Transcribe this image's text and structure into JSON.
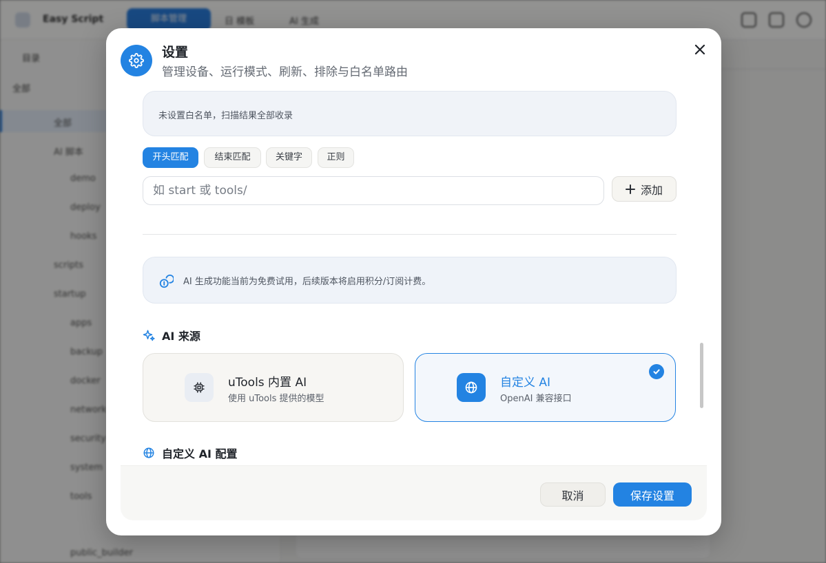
{
  "background_app": {
    "app_name": "Easy Script",
    "active_tab": "脚本管理",
    "tabs": [
      "日 模板",
      "AI 生成"
    ],
    "sidebar_header": "目录",
    "tree_root": "全部",
    "tree_items": [
      "全部",
      "AI 脚本",
      "demo",
      "deploy",
      "hooks",
      "scripts",
      "startup",
      "apps",
      "backup",
      "docker",
      "network",
      "security",
      "system",
      "tools",
      "public_builder"
    ]
  },
  "modal": {
    "title": "设置",
    "subtitle": "管理设备、运行模式、刷新、排除与白名单路由",
    "close_label": "×",
    "whitelist_notice": "未设置白名单，扫描结果全部收录",
    "match_modes": [
      {
        "label": "开头匹配",
        "active": true
      },
      {
        "label": "结束匹配",
        "active": false
      },
      {
        "label": "关键字",
        "active": false
      },
      {
        "label": "正则",
        "active": false
      }
    ],
    "rule_input": {
      "value": "",
      "placeholder": "如 start 或 tools/"
    },
    "add_button": "添加",
    "ai_notice": "AI 生成功能当前为免费试用，后续版本将启用积分/订阅计费。",
    "ai_source_heading": "AI 来源",
    "ai_sources": [
      {
        "title": "uTools 内置 AI",
        "desc": "使用 uTools 提供的模型",
        "icon": "chip-icon",
        "selected": false
      },
      {
        "title": "自定义 AI",
        "desc": "OpenAI 兼容接口",
        "icon": "globe-icon",
        "selected": true
      }
    ],
    "custom_config_heading": "自定义 AI 配置",
    "cancel_button": "取消",
    "save_button": "保存设置"
  },
  "colors": {
    "accent": "#2383e2",
    "overlay": "rgba(0,0,0,0.42)",
    "notice_bg": "#f0f3f8"
  }
}
